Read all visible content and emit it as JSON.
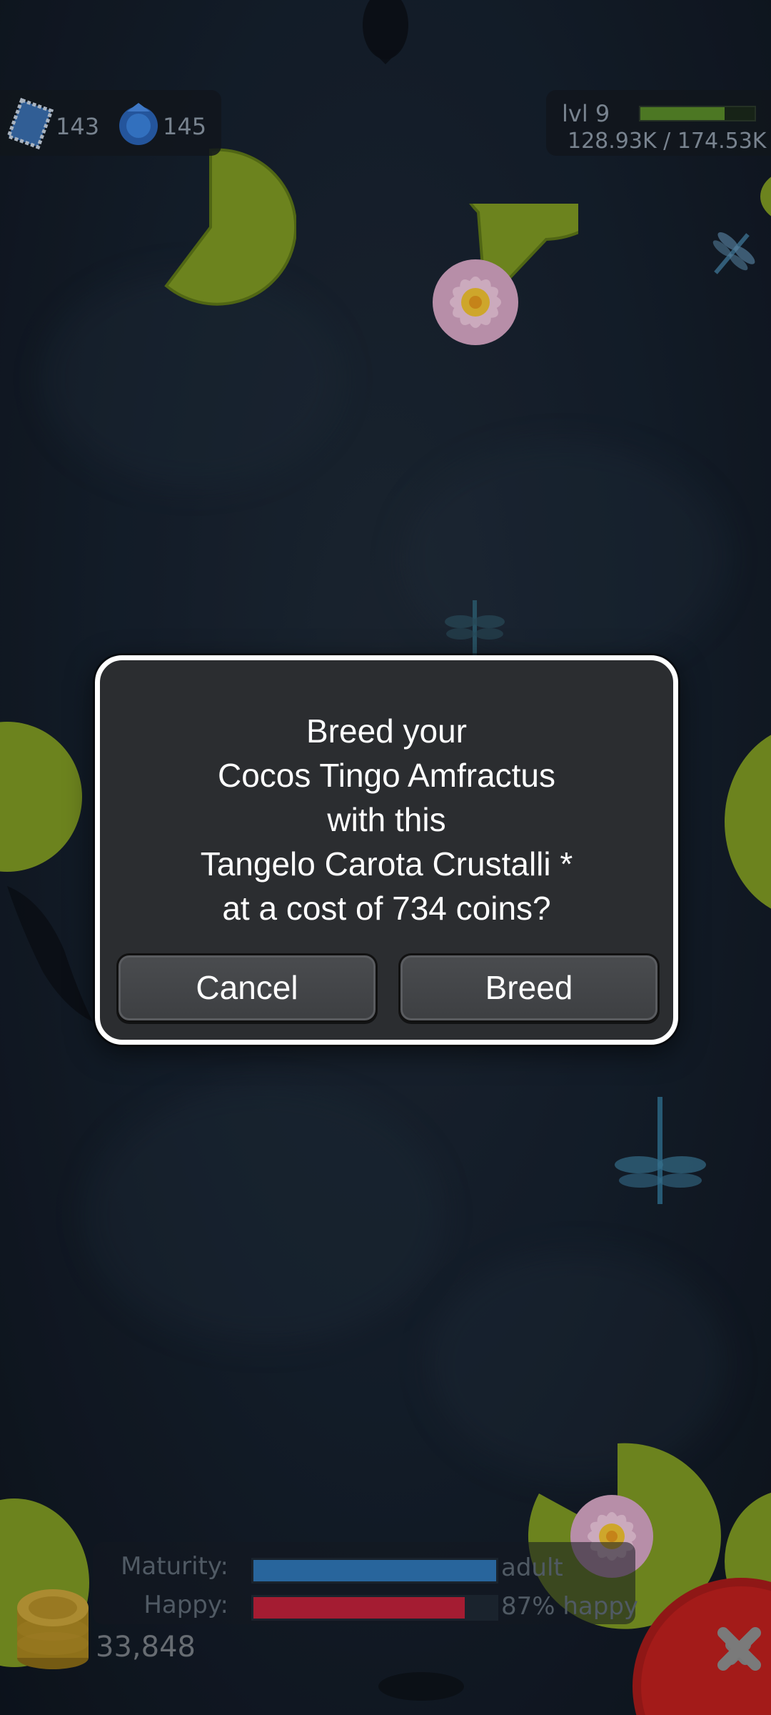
{
  "hud": {
    "stamps_count": "143",
    "gems_count": "145",
    "level_label": "lvl 9",
    "xp_text": "128.93K / 174.53K",
    "xp_progress": 0.739
  },
  "dialog": {
    "message_lines": [
      "Breed your",
      "Cocos Tingo Amfractus",
      "with this",
      "Tangelo Carota Crustalli *",
      "at a cost of 734 coins?"
    ],
    "cancel_label": "Cancel",
    "confirm_label": "Breed"
  },
  "fish_stats": {
    "maturity_label": "Maturity:",
    "maturity_value": "adult",
    "maturity_progress": 1.0,
    "happy_label": "Happy:",
    "happy_value": "87% happy",
    "happy_progress": 0.87
  },
  "wallet": {
    "coins": "33,848"
  },
  "colors": {
    "maturity_bar": "#2f77b8",
    "happy_bar": "#c1223b",
    "close_button": "#c0201e",
    "xp_bar": "#5a8c2a"
  }
}
